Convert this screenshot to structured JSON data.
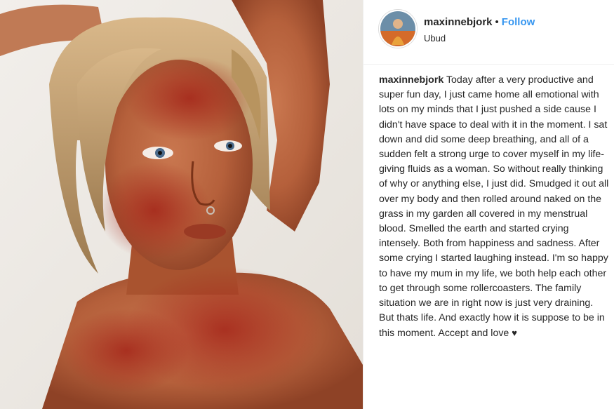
{
  "post": {
    "username": "maxinnebjork",
    "separator": "•",
    "follow_label": "Follow",
    "location": "Ubud",
    "caption": {
      "username": "maxinnebjork",
      "text": "Today after a very productive and super fun day, I just came home all emotional with lots on my minds that I just pushed a side cause I didn't have space to deal with it in the moment. I sat down and did some deep breathing, and all of a sudden felt a strong urge to cover myself in my life-giving fluids as a woman. So without really thinking of why or anything else, I just did. Smudged it out all over my body and then rolled around naked on the grass in my garden all covered in my menstrual blood. Smelled the earth and started crying intensely. Both from happiness and sadness. After some crying I started laughing instead. I'm so happy to have my mum in my life, we both help each other to get through some rollercoasters. The family situation we are in right now is just very draining. But thats life. And exactly how it is suppose to be in this moment. Accept and love",
      "heart": "♥"
    },
    "colors": {
      "follow": "#3897f0",
      "text": "#262626",
      "border": "#efefef"
    }
  }
}
